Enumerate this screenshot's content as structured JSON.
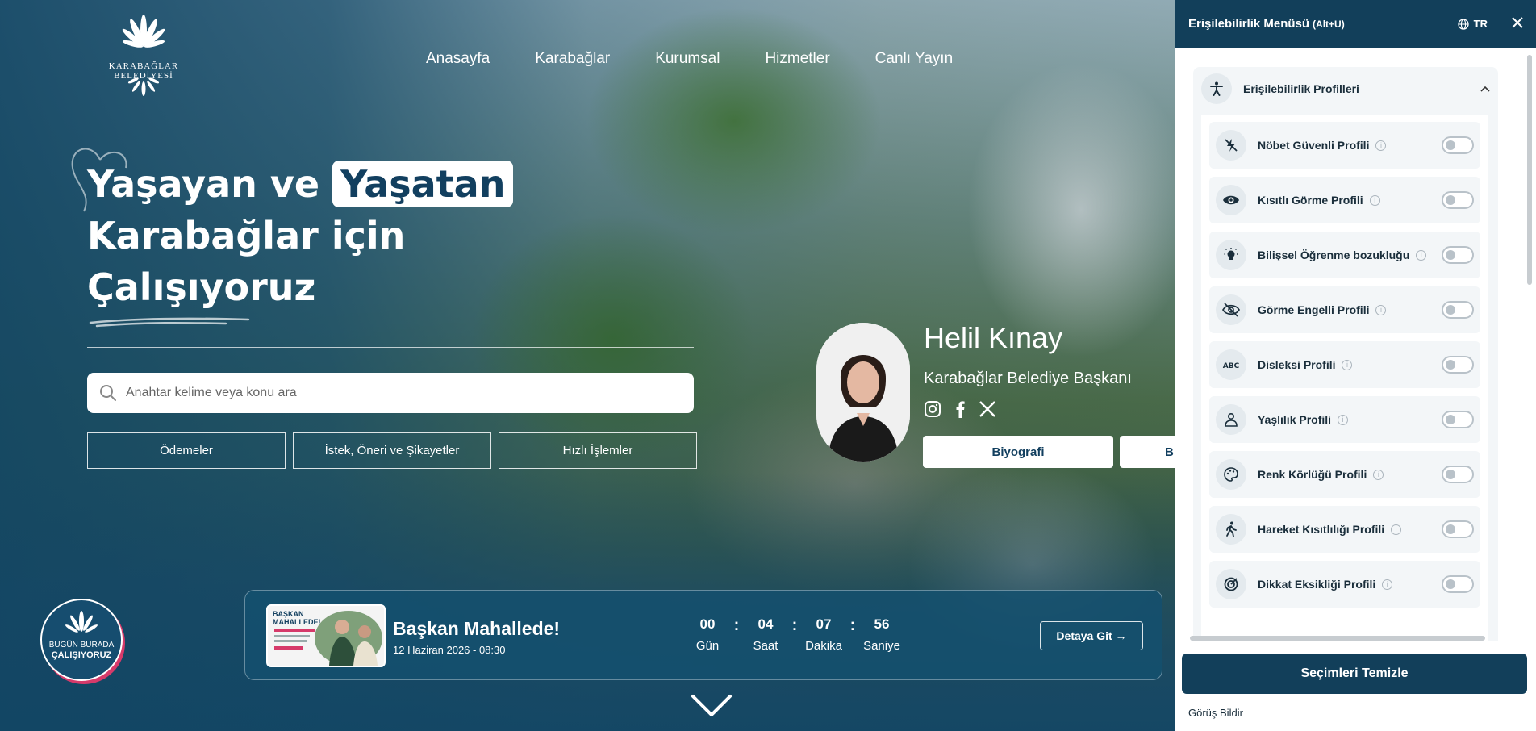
{
  "logo": {
    "text": "KARABAĞLAR BELEDİYESİ"
  },
  "nav": {
    "items": [
      "Anasayfa",
      "Karabağlar",
      "Kurumsal",
      "Hizmetler",
      "Canlı Yayın"
    ]
  },
  "hero": {
    "line1": "Yaşayan ve",
    "line1_highlight": "Yaşatan",
    "line2": "Karabağlar için",
    "line3": "Çalışıyoruz"
  },
  "search": {
    "placeholder": "Anahtar kelime veya konu ara",
    "value": ""
  },
  "quick_links": [
    "Ödemeler",
    "İstek, Öneri ve Şikayetler",
    "Hızlı İşlemler"
  ],
  "mayor": {
    "name": "Helil Kınay",
    "title": "Karabağlar Belediye Başkanı",
    "social": [
      "instagram-icon",
      "facebook-icon",
      "x-icon"
    ],
    "buttons": [
      "Biyografi",
      "B"
    ]
  },
  "badge": {
    "line1": "BUGÜN BURADA",
    "line2": "ÇALIŞIYORUZ"
  },
  "event": {
    "thumb_title": "BAŞKAN MAHALLEDE!",
    "title": "Başkan Mahallede!",
    "date": "12 Haziran 2026 - 08:30",
    "countdown": [
      {
        "value": "00",
        "label": "Gün"
      },
      {
        "value": "04",
        "label": "Saat"
      },
      {
        "value": "07",
        "label": "Dakika"
      },
      {
        "value": "56",
        "label": "Saniye"
      }
    ],
    "separator": ":",
    "button": "Detaya Git →"
  },
  "accessibility": {
    "title": "Erişilebilirlik Menüsü",
    "shortcut": "(Alt+U)",
    "language": "TR",
    "section_title": "Erişilebilirlik Profilleri",
    "profiles": [
      {
        "label": "Nöbet Güvenli Profili",
        "icon": "lightning-off-icon",
        "enabled": false
      },
      {
        "label": "Kısıtlı Görme Profili",
        "icon": "eye-icon",
        "enabled": false
      },
      {
        "label": "Bilişsel Öğrenme bozukluğu",
        "icon": "lightbulb-icon",
        "enabled": false
      },
      {
        "label": "Görme Engelli Profili",
        "icon": "eye-off-icon",
        "enabled": false
      },
      {
        "label": "Disleksi Profili",
        "icon": "abc-icon",
        "enabled": false
      },
      {
        "label": "Yaşlılık Profili",
        "icon": "person-icon",
        "enabled": false
      },
      {
        "label": "Renk Körlüğü Profili",
        "icon": "palette-icon",
        "enabled": false
      },
      {
        "label": "Hareket Kısıtlılığı Profili",
        "icon": "walking-icon",
        "enabled": false
      },
      {
        "label": "Dikkat Eksikliği Profili",
        "icon": "target-icon",
        "enabled": false
      }
    ],
    "clear_button": "Seçimleri Temizle",
    "feedback": "Görüş Bildir"
  },
  "colors": {
    "primary": "#123f5a",
    "accent_pink": "#d63a6a",
    "white": "#ffffff"
  }
}
